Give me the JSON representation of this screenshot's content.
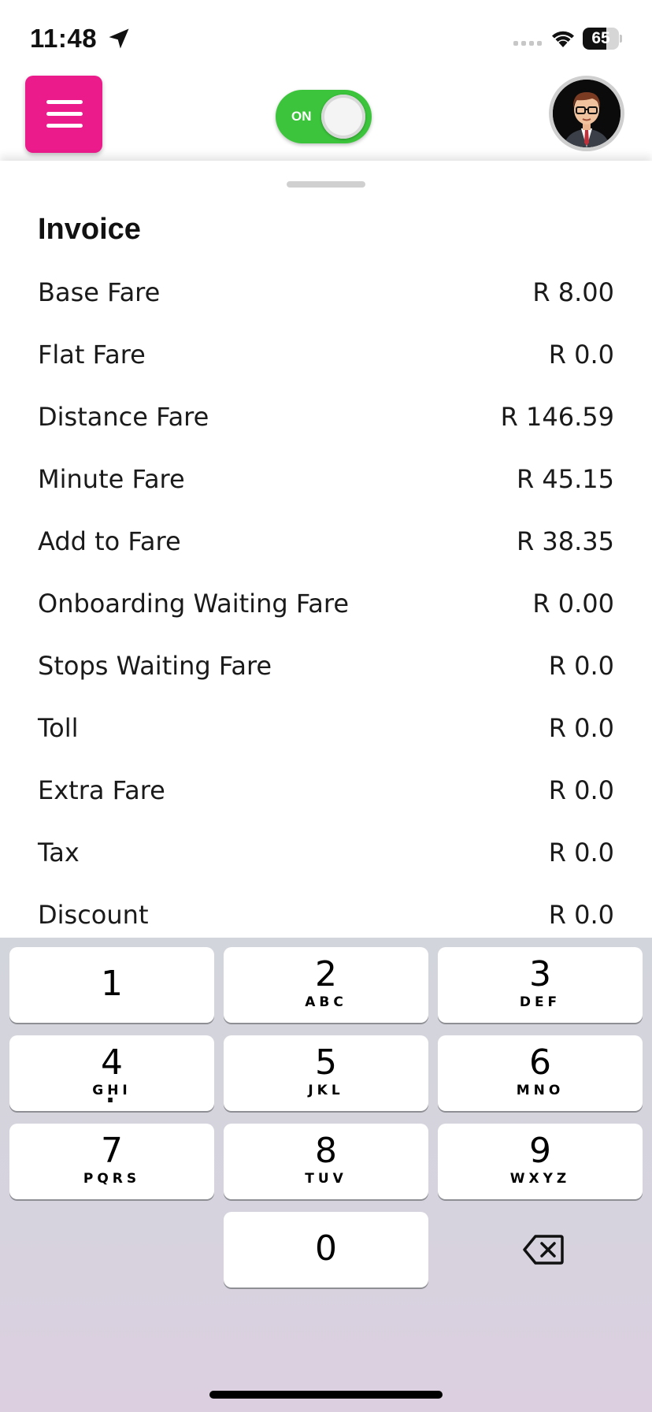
{
  "status_bar": {
    "time": "11:48",
    "battery_level": "65",
    "battery_fraction": 0.65,
    "icons": [
      "location-arrow-icon",
      "cellular-signal-icon",
      "wifi-icon",
      "battery-icon"
    ]
  },
  "header": {
    "menu_icon": "hamburger-menu-icon",
    "menu_color": "#ec1b8c",
    "toggle_label": "ON",
    "toggle_color": "#3cc53c",
    "toggle_state": "on",
    "avatar_icon": "driver-avatar"
  },
  "invoice": {
    "title": "Invoice",
    "rows": [
      {
        "label": "Base Fare",
        "value": "R 8.00"
      },
      {
        "label": "Flat Fare",
        "value": "R 0.0"
      },
      {
        "label": "Distance Fare",
        "value": "R 146.59"
      },
      {
        "label": "Minute Fare",
        "value": "R 45.15"
      },
      {
        "label": "Add to Fare",
        "value": "R 38.35"
      },
      {
        "label": "Onboarding Waiting Fare",
        "value": "R 0.00"
      },
      {
        "label": "Stops Waiting Fare",
        "value": "R 0.0"
      },
      {
        "label": "Toll",
        "value": "R 0.0"
      },
      {
        "label": "Extra Fare",
        "value": "R 0.0"
      },
      {
        "label": "Tax",
        "value": "R 0.0"
      },
      {
        "label": "Discount",
        "value": "R 0.0"
      }
    ]
  },
  "keypad": {
    "keys": [
      {
        "digit": "1",
        "letters": ""
      },
      {
        "digit": "2",
        "letters": "ABC"
      },
      {
        "digit": "3",
        "letters": "DEF"
      },
      {
        "digit": "4",
        "letters": "GHI"
      },
      {
        "digit": "5",
        "letters": "JKL"
      },
      {
        "digit": "6",
        "letters": "MNO"
      },
      {
        "digit": "7",
        "letters": "PQRS"
      },
      {
        "digit": "8",
        "letters": "TUV"
      },
      {
        "digit": "9",
        "letters": "WXYZ"
      },
      {
        "digit": "0",
        "letters": ""
      }
    ],
    "decimal": ".",
    "backspace_icon": "backspace-icon"
  }
}
